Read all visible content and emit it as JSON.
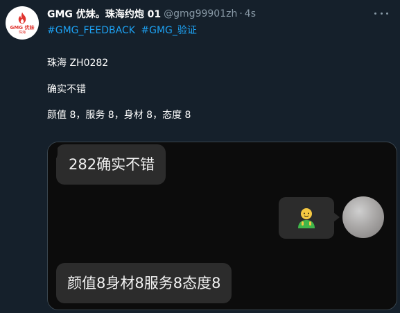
{
  "tweet": {
    "avatar_logo_text": "GMG 优妹",
    "avatar_logo_sub": "珠海",
    "display_name": "GMG 优妹。珠海约炮 01",
    "handle": "@gmg99901zh",
    "separator": "·",
    "time": "4s",
    "hashtags": [
      "#GMG_FEEDBACK",
      "#GMG_验证"
    ],
    "lines": [
      "珠海 ZH0282",
      "确实不错",
      "颜值 8，服务 8，身材 8，态度 8"
    ]
  },
  "media": {
    "message_top": "282确实不错",
    "message_bottom": "颜值8身材8服务8态度8",
    "emoji_name": "person-emoji"
  },
  "colors": {
    "background": "#15202b",
    "link": "#1da1f2",
    "muted": "#8899a6",
    "logo_red": "#e0342f",
    "chat_bubble": "#2c2c2c"
  }
}
